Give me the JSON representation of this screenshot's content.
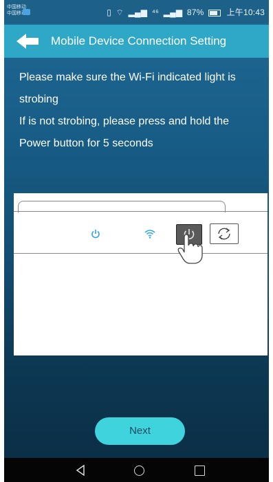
{
  "statusbar": {
    "carrier1": "中国移动",
    "carrier2": "中国移动",
    "network": "⁴⁶",
    "battery": "87%",
    "time": "上午10:43"
  },
  "header": {
    "title": "Mobile Device Connection Setting",
    "back_icon": "back-arrow-icon"
  },
  "instructions": {
    "line1": "Please make sure the Wi-Fi indicated light is",
    "line2": "strobing",
    "line3": "If is not strobing, please press and hold the",
    "line4": "Power button for 5 seconds"
  },
  "device": {
    "power_indicator_color": "#2aa6e0",
    "wifi_indicator_color": "#2aa6e0"
  },
  "actions": {
    "next_label": "Next"
  },
  "colors": {
    "header": "#2fa7c6",
    "next_button": "#3fd3dd"
  }
}
